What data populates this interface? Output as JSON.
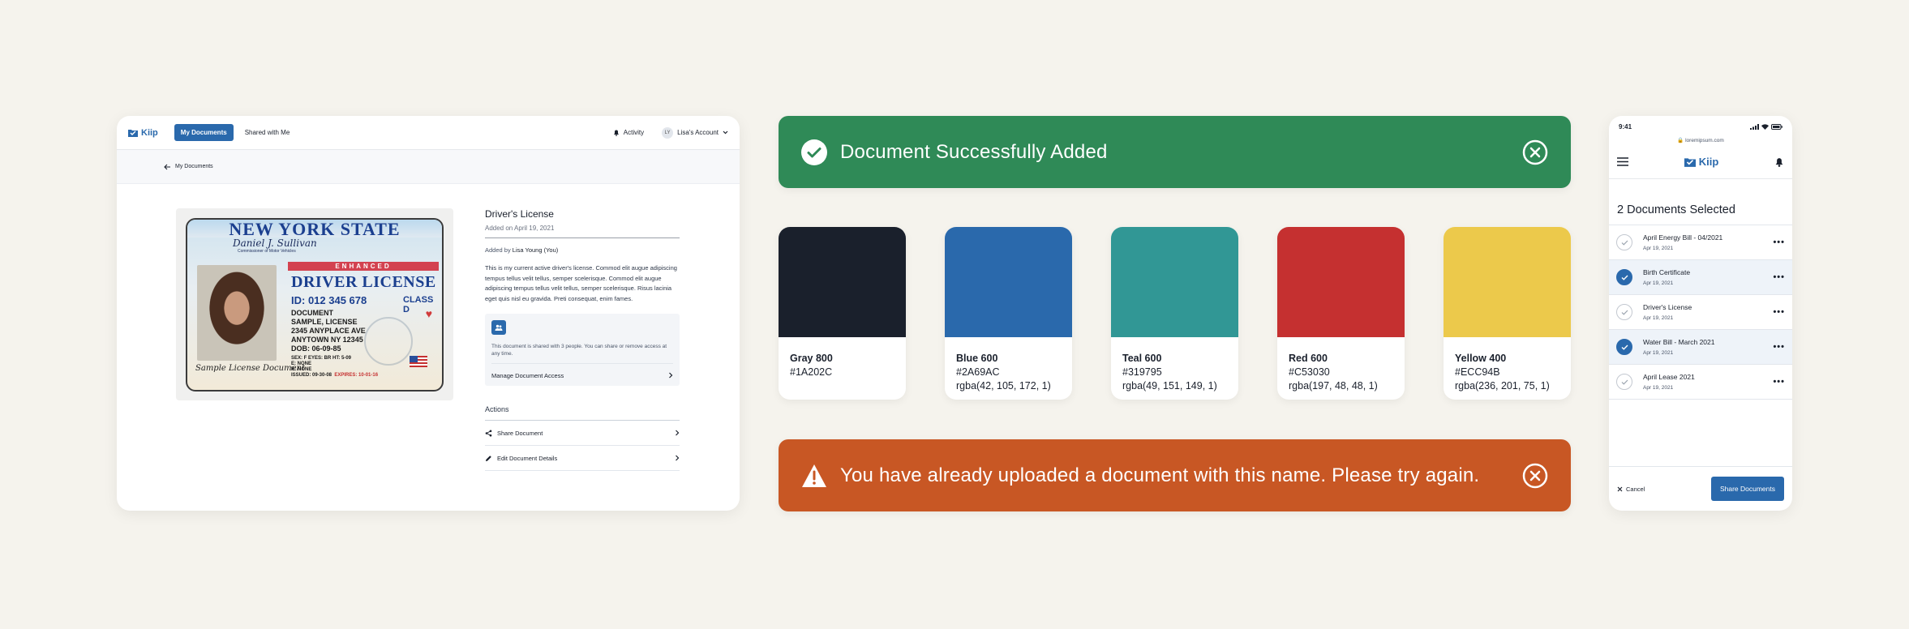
{
  "desktop": {
    "brand": "Kiip",
    "nav": {
      "my_documents": "My Documents",
      "shared": "Shared with Me"
    },
    "activity": "Activity",
    "account": {
      "initials": "LY",
      "label": "Lisa's Account"
    },
    "breadcrumb": "My Documents",
    "license": {
      "state": "NEW YORK STATE",
      "signature": "Daniel J. Sullivan",
      "commissioner": "Commissioner of Motor Vehicles",
      "enhanced": "ENHANCED",
      "heading": "DRIVER LICENSE",
      "id": "ID: 012 345 678",
      "class": "CLASS D",
      "info": [
        "DOCUMENT",
        "SAMPLE, LICENSE",
        "2345 ANYPLACE AVE",
        "ANYTOWN NY 12345",
        "DOB: 06-09-85"
      ],
      "fine1": "SEX: F   EYES: BR   HT: 5-09",
      "fine2": "E: NONE",
      "fine3": "R: NONE",
      "issued": "ISSUED: 09-30-08",
      "expires": "EXPIRES: 10-01-16",
      "sample_signature": "Sample License Document"
    },
    "doc": {
      "title": "Driver's License",
      "added_on": "Added on April 19, 2021",
      "added_by_prefix": "Added by",
      "added_by": "Lisa Young (You)",
      "description": "This is my current active driver's license. Commod elit augue adipiscing tempus tellus velit tellus, semper scelerisque. Commod elit augue adipiscing tempus tellus velit tellus, semper scelerisque. Risus lacinia eget quis nisl eu gravida. Preti consequat, enim fames.",
      "share_text": "This document is shared with 3 people. You can share or remove access at any time.",
      "manage": "Manage Document Access",
      "actions_heading": "Actions",
      "share_action": "Share Document",
      "edit_action": "Edit Document Details"
    }
  },
  "toasts": {
    "success": {
      "text": "Document Successfully Added",
      "color": "#2F8A57"
    },
    "error": {
      "text": "You have already uploaded a document with this name. Please try again.",
      "color": "#C85724"
    }
  },
  "swatches": [
    {
      "name": "Gray 800",
      "hex": "#1A202C",
      "rgba": "",
      "color": "#1A202C"
    },
    {
      "name": "Blue 600",
      "hex": "#2A69AC",
      "rgba": "rgba(42, 105, 172, 1)",
      "color": "#2A69AC"
    },
    {
      "name": "Teal 600",
      "hex": "#319795",
      "rgba": "rgba(49, 151, 149, 1)",
      "color": "#319795"
    },
    {
      "name": "Red 600",
      "hex": "#C53030",
      "rgba": "rgba(197, 48, 48, 1)",
      "color": "#C53030"
    },
    {
      "name": "Yellow 400",
      "hex": "#ECC94B",
      "rgba": "rgba(236, 201, 75, 1)",
      "color": "#ECC94B"
    }
  ],
  "mobile": {
    "time": "9:41",
    "url": "loremipsum.com",
    "brand": "Kiip",
    "selected_heading": "2 Documents Selected",
    "items": [
      {
        "name": "April Energy Bill - 04/2021",
        "date": "Apr 19, 2021",
        "selected": false
      },
      {
        "name": "Birth Certificate",
        "date": "Apr 19, 2021",
        "selected": true
      },
      {
        "name": "Driver's License",
        "date": "Apr 19, 2021",
        "selected": false
      },
      {
        "name": "Water Bill - March 2021",
        "date": "Apr 19, 2021",
        "selected": true
      },
      {
        "name": "April Lease 2021",
        "date": "Apr 19, 2021",
        "selected": false
      }
    ],
    "cancel": "Cancel",
    "share": "Share Documents"
  },
  "icons": [
    "kiip-logo-icon",
    "bell-icon",
    "chevron-down-icon",
    "arrow-left-icon",
    "people-icon",
    "chevron-right-icon",
    "share-icon",
    "pencil-icon",
    "check-circle-icon",
    "warning-icon",
    "close-circle-icon",
    "menu-icon",
    "notification-bell-icon",
    "lock-icon",
    "check-icon",
    "more-dots-icon",
    "close-icon"
  ]
}
